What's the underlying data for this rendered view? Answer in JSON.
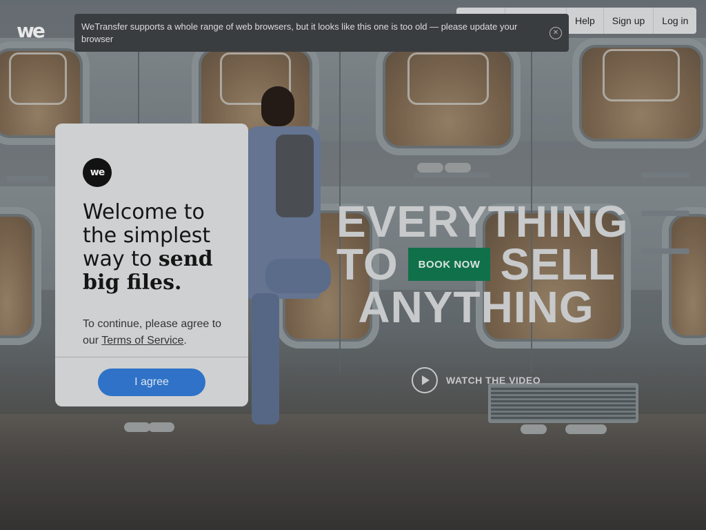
{
  "logo": {
    "text": "we"
  },
  "topnav": {
    "items": [
      {
        "label": "",
        "name": "nav-item-blank-1"
      },
      {
        "label": "",
        "name": "nav-item-blank-2"
      },
      {
        "label": "Help"
      },
      {
        "label": "Sign up"
      },
      {
        "label": "Log in"
      }
    ]
  },
  "banner": {
    "message": "WeTransfer supports a whole range of web browsers, but it looks like this one is too old — please update your browser",
    "close_icon": "close-circle-icon"
  },
  "modal": {
    "logo_text": "we",
    "title_plain": "Welcome to the simplest way to ",
    "title_emphasis": "send big files.",
    "text_before": "To continue, please agree to our ",
    "terms_link": "Terms of Service",
    "text_after": ".",
    "agree_label": "I agree"
  },
  "hero": {
    "line1": "EVERYTHING",
    "line2_left": "TO",
    "book_now": "BOOK NOW",
    "line2_right": "SELL",
    "line3": "ANYTHING",
    "watch_label": "WATCH THE VIDEO",
    "play_icon": "play-icon"
  },
  "colors": {
    "book_now_bg": "#10704a",
    "agree_bg": "#2f72c7",
    "banner_bg": "#3a3d40"
  }
}
